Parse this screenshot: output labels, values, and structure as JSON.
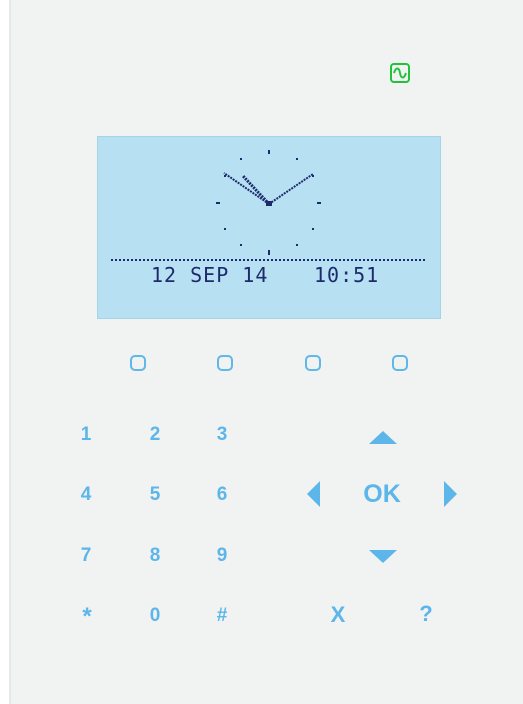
{
  "device": {
    "status_icon": "power-indicator-icon",
    "status_color": "#22c23a"
  },
  "display": {
    "date": "12 SEP 14",
    "time": "10:51",
    "clock_icon": "analog-clock-icon",
    "background_color": "#b7e0f3",
    "text_color": "#1d2a6b"
  },
  "soft_keys": [
    "soft-key-1",
    "soft-key-2",
    "soft-key-3",
    "soft-key-4"
  ],
  "keypad": {
    "key_1": "1",
    "key_2": "2",
    "key_3": "3",
    "key_4": "4",
    "key_5": "5",
    "key_6": "6",
    "key_7": "7",
    "key_8": "8",
    "key_9": "9",
    "key_star": "*",
    "key_0": "0",
    "key_hash": "#"
  },
  "navigation": {
    "ok": "OK",
    "cancel": "X",
    "help": "?",
    "up_icon": "arrow-up-icon",
    "down_icon": "arrow-down-icon",
    "left_icon": "arrow-left-icon",
    "right_icon": "arrow-right-icon"
  },
  "accent_color": "#5cb6e9"
}
